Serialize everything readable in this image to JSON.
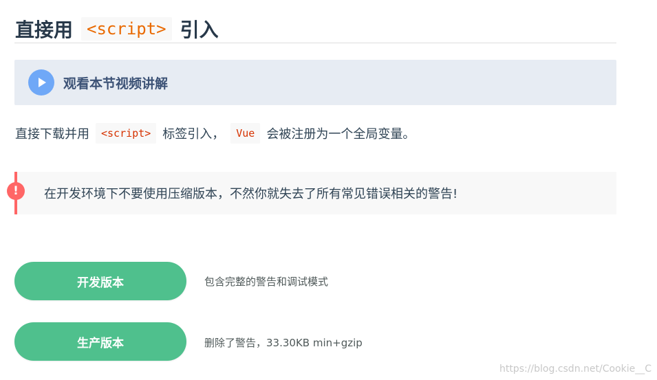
{
  "heading": {
    "before": "直接用",
    "code": "<script>",
    "after": "引入"
  },
  "video_link": {
    "icon": "play-icon",
    "label": "观看本节视频讲解"
  },
  "intro": {
    "text1": "直接下载并用",
    "code1": "<script>",
    "text2": "标签引入，",
    "code2": "Vue",
    "text3": "会被注册为一个全局变量。"
  },
  "warning": {
    "icon": "!",
    "text": "在开发环境下不要使用压缩版本，不然你就失去了所有常见错误相关的警告!"
  },
  "downloads": [
    {
      "label": "开发版本",
      "description": "包含完整的警告和调试模式"
    },
    {
      "label": "生产版本",
      "description": "删除了警告，33.30KB min+gzip"
    }
  ],
  "watermark": "https://blog.csdn.net/Cookie__C",
  "colors": {
    "accent": "#4fc08d",
    "warning": "#ff6666",
    "play": "#6fa8f7",
    "code": "#e96900"
  }
}
